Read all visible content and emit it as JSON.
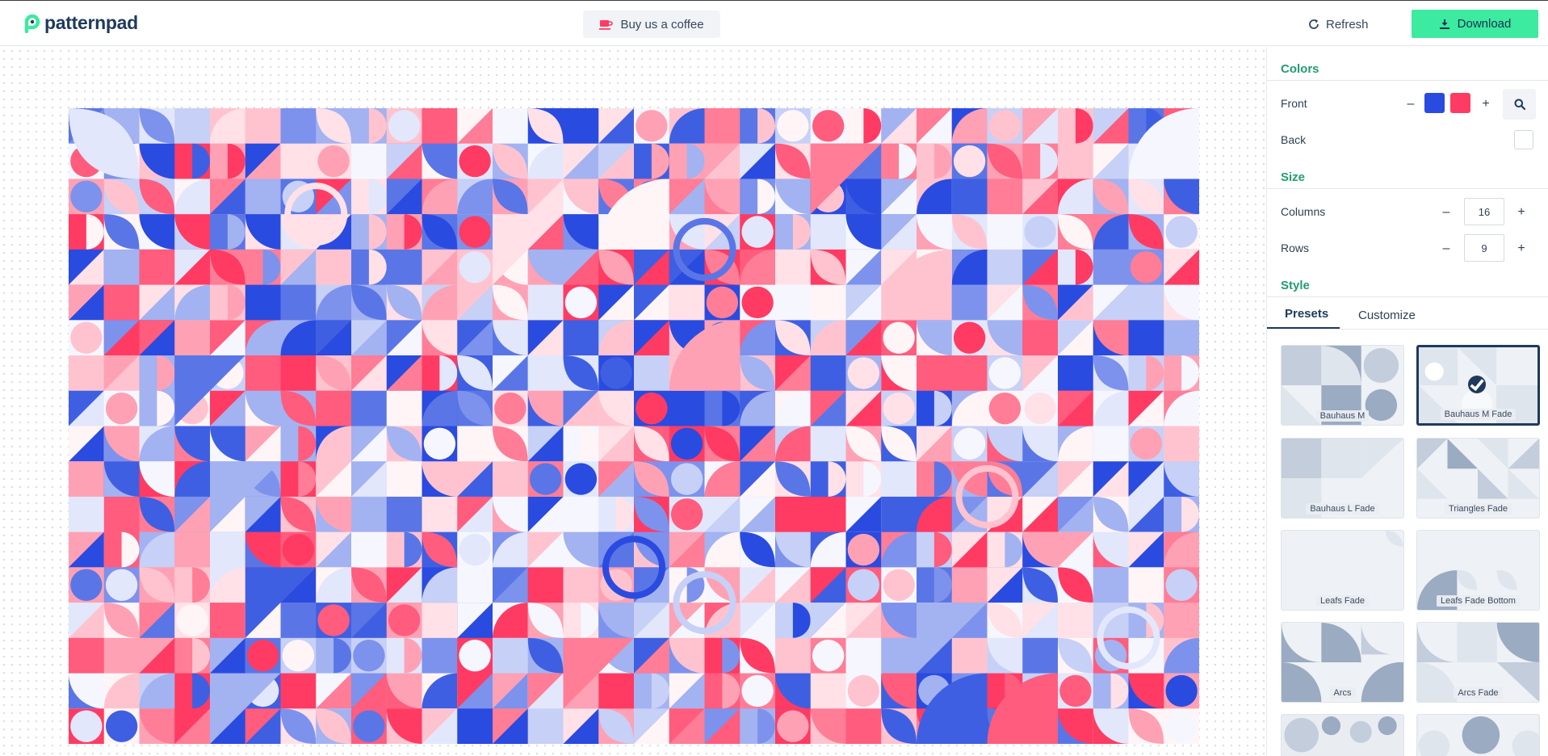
{
  "header": {
    "logo_text": "patternpad",
    "coffee_label": "Buy us a coffee",
    "refresh_label": "Refresh",
    "download_label": "Download",
    "download_color": "#3ceaa0"
  },
  "panel": {
    "colors_title": "Colors",
    "front_label": "Front",
    "front_colors": [
      "#2a4be0",
      "#ff3b63"
    ],
    "back_label": "Back",
    "back_color": "#ffffff",
    "size_title": "Size",
    "columns_label": "Columns",
    "columns_value": "16",
    "rows_label": "Rows",
    "rows_value": "9",
    "style_title": "Style",
    "tabs": [
      "Presets",
      "Customize"
    ],
    "active_tab": "Presets",
    "presets": [
      {
        "label": "Bauhaus M",
        "selected": false
      },
      {
        "label": "Bauhaus M Fade",
        "selected": true
      },
      {
        "label": "Bauhaus L Fade",
        "selected": false
      },
      {
        "label": "Triangles Fade",
        "selected": false
      },
      {
        "label": "Leafs Fade",
        "selected": false
      },
      {
        "label": "Leafs Fade Bottom",
        "selected": false
      },
      {
        "label": "Arcs",
        "selected": false
      },
      {
        "label": "Arcs Fade",
        "selected": false
      }
    ]
  },
  "icons": {
    "logo": "patternpad-logo-icon",
    "coffee": "coffee-cup-icon",
    "refresh": "refresh-icon",
    "download": "download-icon",
    "search": "search-icon",
    "check": "check-icon"
  },
  "pattern": {
    "columns": 16,
    "rows": 9,
    "palette": [
      "#2a4be0",
      "#3f5fe2",
      "#5a76e6",
      "#7d92ec",
      "#a3b2f1",
      "#c7d0f6",
      "#e2e7fb",
      "#f6f7fe",
      "#ff3b63",
      "#ff5c7e",
      "#ff7d96",
      "#ffa1b4",
      "#ffc3cf",
      "#ffe1e7",
      "#fff5f7"
    ]
  }
}
